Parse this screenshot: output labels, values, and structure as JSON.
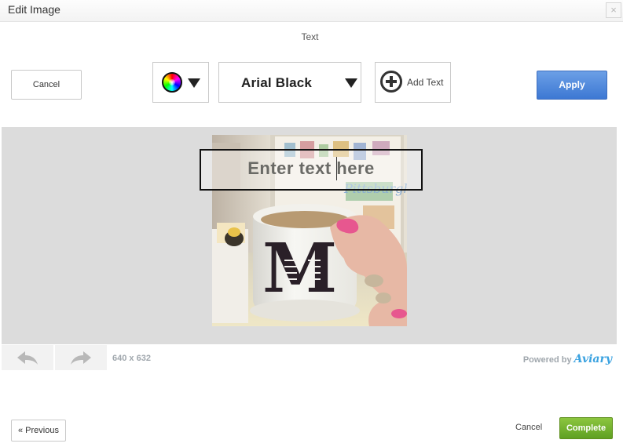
{
  "dialog": {
    "title": "Edit Image",
    "close_symbol": "×"
  },
  "toolbar": {
    "label": "Text",
    "cancel_label": "Cancel",
    "font_name": "Arial Black",
    "add_text_label": "Add Text",
    "apply_label": "Apply"
  },
  "canvas": {
    "overlay_text": "Enter text here",
    "dimensions": "640 x 632"
  },
  "branding": {
    "powered_by": "Powered by",
    "brand": "Aviary"
  },
  "footer": {
    "previous_label": "« Previous",
    "cancel_label": "Cancel",
    "complete_label": "Complete"
  },
  "colors": {
    "apply": "#4a86da",
    "complete": "#76b42f",
    "canvas_bg": "#dcdcdc"
  }
}
